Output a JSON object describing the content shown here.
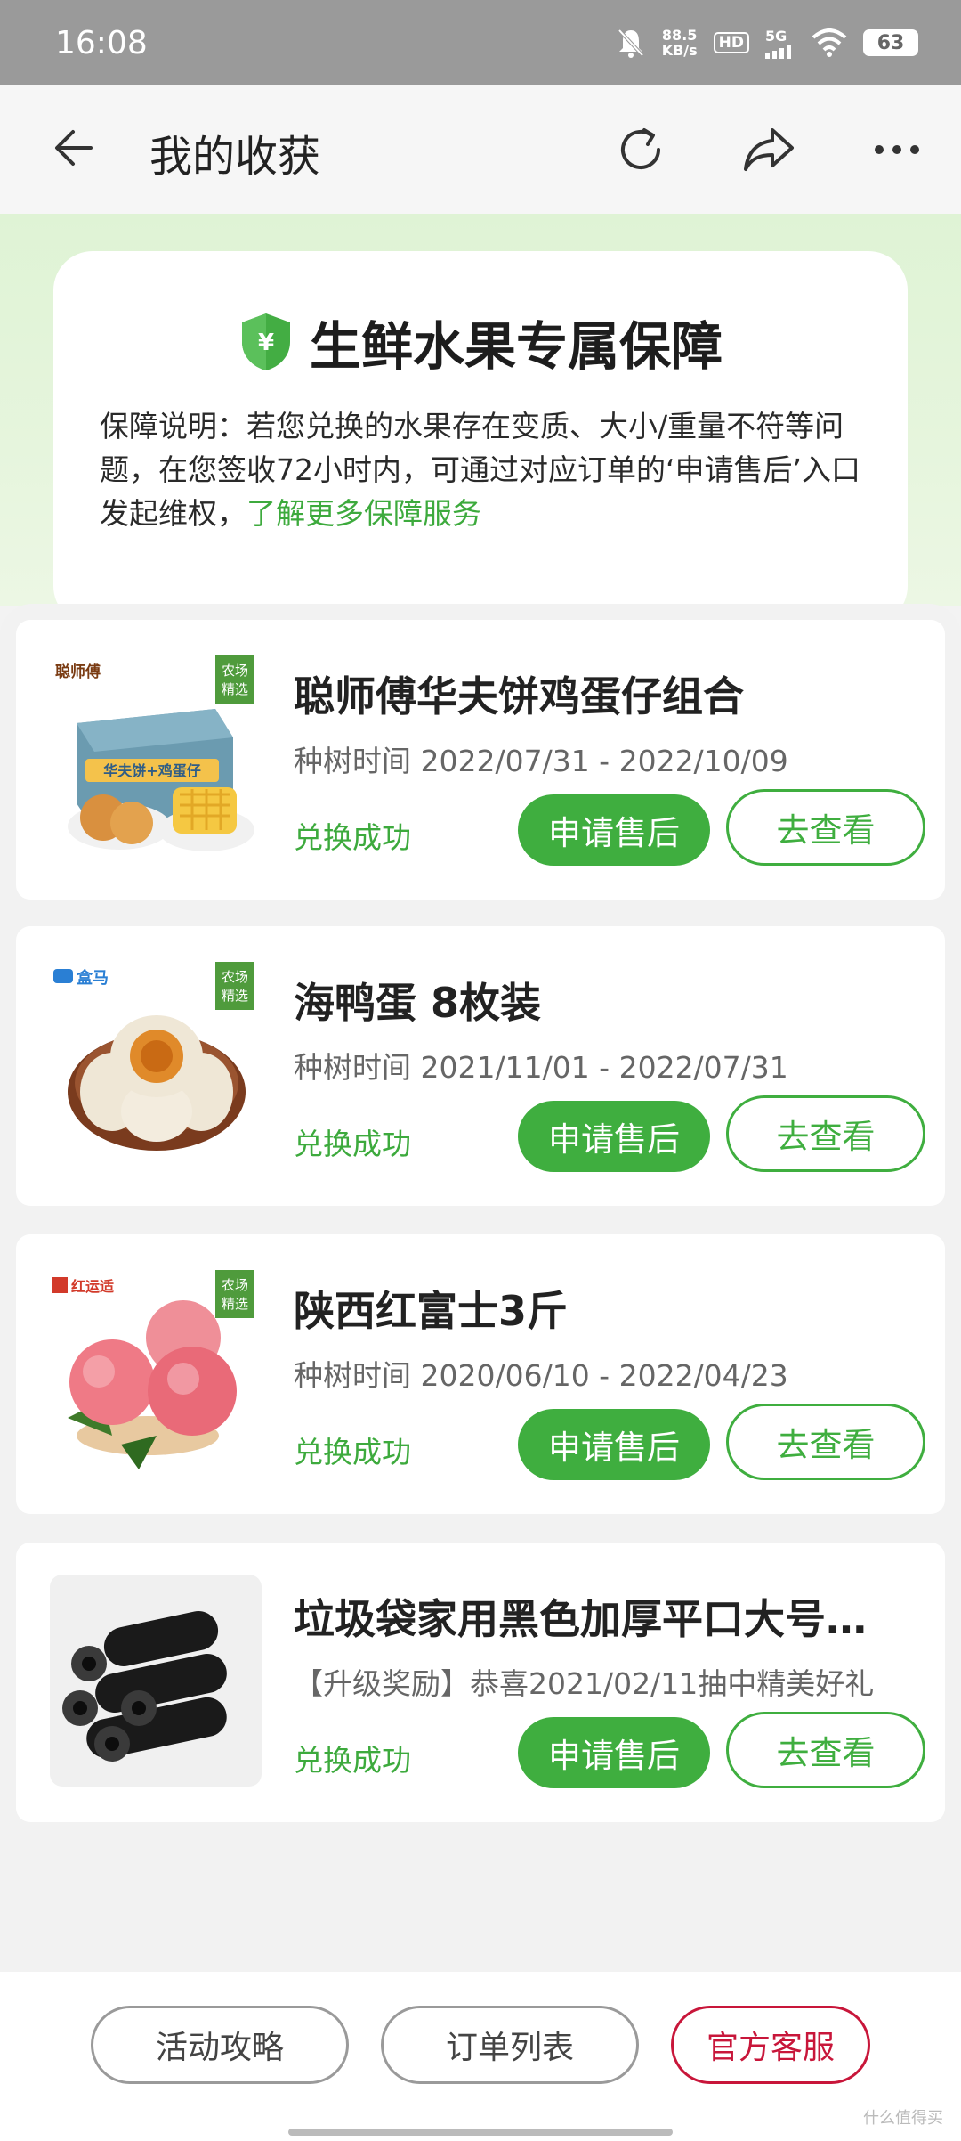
{
  "status_bar": {
    "time": "16:08",
    "speed_top": "88.5",
    "speed_unit": "KB/s",
    "hd": "HD",
    "net": "5G",
    "battery": "63"
  },
  "header": {
    "title": "我的收获"
  },
  "protection": {
    "title": "生鲜水果专属保障",
    "description": "保障说明：若您兑换的水果存在变质、大小/重量不符等问题，在您签收72小时内，可通过对应订单的‘申请售后’入口发起维权，",
    "link": "了解更多保障服务"
  },
  "items": [
    {
      "name": "聪师傅华夫饼鸡蛋仔组合",
      "time": "种树时间 2022/07/31 - 2022/10/09",
      "status": "兑换成功",
      "btn_after_sale": "申请售后",
      "btn_view": "去查看",
      "brand": "聪师傅",
      "tag": "农场精选",
      "box_text": "华夫饼+鸡蛋仔"
    },
    {
      "name": "海鸭蛋 8枚装",
      "time": "种树时间 2021/11/01 - 2022/07/31",
      "status": "兑换成功",
      "btn_after_sale": "申请售后",
      "btn_view": "去查看",
      "brand": "盒马",
      "tag": "农场精选"
    },
    {
      "name": "陕西红富士3斤",
      "time": "种树时间 2020/06/10 - 2022/04/23",
      "status": "兑换成功",
      "btn_after_sale": "申请售后",
      "btn_view": "去查看",
      "brand": "红运适",
      "tag": "农场精选"
    },
    {
      "name": "垃圾袋家用黑色加厚平口大号…",
      "time": "【升级奖励】恭喜2021/02/11抽中精美好礼",
      "status": "兑换成功",
      "btn_after_sale": "申请售后",
      "btn_view": "去查看"
    }
  ],
  "bottom_bar": {
    "guide": "活动攻略",
    "orders": "订单列表",
    "service": "官方客服"
  },
  "watermark": "什么值得买",
  "colors": {
    "accent_green": "#3fae3f",
    "link_green": "#3daa3d",
    "service_red": "#c8163a"
  }
}
